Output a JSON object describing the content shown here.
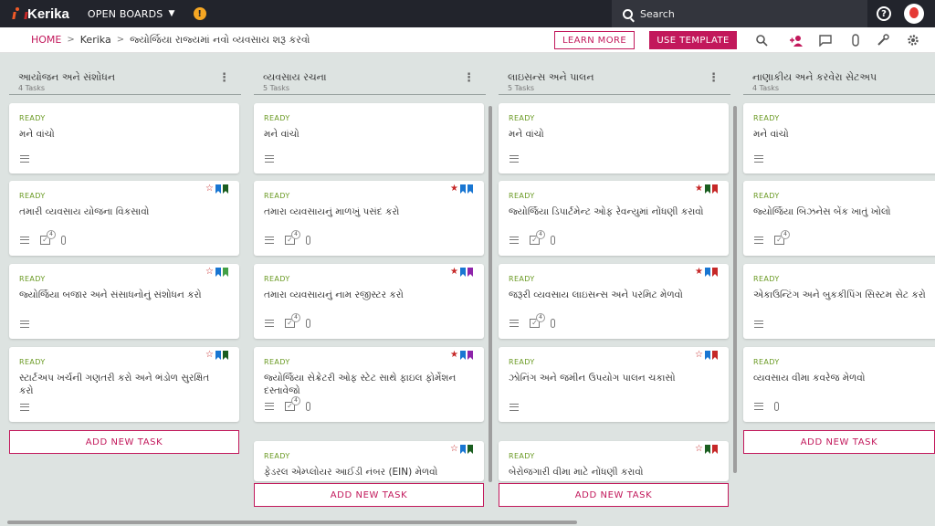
{
  "topbar": {
    "logo": "Kerika",
    "open_boards": "OPEN BOARDS",
    "alert": "!",
    "search_placeholder": "Search",
    "help": "?"
  },
  "breadcrumb": {
    "home": "HOME",
    "org": "Kerika",
    "board": "જ્યોર્જિયા રાજ્યમાં નવો વ્યવસાય શરૂ કરવો"
  },
  "buttons": {
    "learn_more": "LEARN MORE",
    "use_template": "USE TEMPLATE"
  },
  "colors": {
    "accent": "#c2185b",
    "ready": "#6a9a23",
    "topbar": "#22242c",
    "board_bg": "#dde3e1"
  },
  "columns": [
    {
      "title": "આયોજન અને સંશોધન",
      "count": "4 Tasks",
      "add_task": "ADD NEW TASK",
      "cards": [
        {
          "status": "READY",
          "title": "મને વાંચો",
          "star": "",
          "flags": [],
          "checklist": "",
          "attachment": false
        },
        {
          "status": "READY",
          "title": "તમારી વ્યવસાય યોજના વિકસાવો",
          "star": "empty",
          "flags": [
            "#1976d2",
            "#1b5e20"
          ],
          "checklist": "4",
          "attachment": true
        },
        {
          "status": "READY",
          "title": "જ્યોર્જિયા બજાર અને સંસાધનોનું સંશોધન કરો",
          "star": "empty",
          "flags": [
            "#1976d2",
            "#43a047"
          ],
          "checklist": "",
          "attachment": false
        },
        {
          "status": "READY",
          "title": "સ્ટાર્ટઅપ ખર્ચની ગણતરી કરો અને ભંડોળ સુરક્ષિત કરો",
          "star": "empty",
          "flags": [
            "#1976d2",
            "#1b5e20"
          ],
          "checklist": "",
          "attachment": false
        }
      ]
    },
    {
      "title": "વ્યવસાય રચના",
      "count": "5 Tasks",
      "add_task": "ADD NEW TASK",
      "cards": [
        {
          "status": "READY",
          "title": "મને વાંચો",
          "star": "",
          "flags": [],
          "checklist": "",
          "attachment": false
        },
        {
          "status": "READY",
          "title": "તમારા વ્યવસાયનું માળખું પસંદ કરો",
          "star": "filled",
          "flags": [
            "#1976d2",
            "#1976d2"
          ],
          "checklist": "4",
          "attachment": true
        },
        {
          "status": "READY",
          "title": "તમારા વ્યવસાયનું નામ રજીસ્ટર કરો",
          "star": "filled",
          "flags": [
            "#1976d2",
            "#8e24aa"
          ],
          "checklist": "4",
          "attachment": true
        },
        {
          "status": "READY",
          "title": "જ્યોર્જિયા સેક્રેટરી ઓફ સ્ટેટ સાથે ફાઇલ ફોર્મેશન દસ્તાવેજો",
          "star": "filled",
          "flags": [
            "#1976d2",
            "#8e24aa"
          ],
          "checklist": "4",
          "attachment": true
        },
        {
          "status": "READY",
          "title": "ફેડરલ એમ્પ્લોયર આઈડી નંબર (EIN) મેળવો",
          "star": "empty",
          "flags": [
            "#1976d2",
            "#1b5e20"
          ],
          "checklist": "",
          "attachment": false
        }
      ]
    },
    {
      "title": "લાઇસન્સ અને પાલન",
      "count": "5 Tasks",
      "add_task": "ADD NEW TASK",
      "cards": [
        {
          "status": "READY",
          "title": "મને વાંચો",
          "star": "",
          "flags": [],
          "checklist": "",
          "attachment": false
        },
        {
          "status": "READY",
          "title": "જ્યોર્જિયા ડિપાર્ટમેન્ટ ઓફ રેવન્યુમાં નોંધણી કરાવો",
          "star": "filled",
          "flags": [
            "#1b5e20",
            "#c62828"
          ],
          "checklist": "4",
          "attachment": true
        },
        {
          "status": "READY",
          "title": "જરૂરી વ્યવસાય લાઇસન્સ અને પરમિટ મેળવો",
          "star": "filled",
          "flags": [
            "#1976d2",
            "#c62828"
          ],
          "checklist": "4",
          "attachment": true
        },
        {
          "status": "READY",
          "title": "ઝોનિંગ અને જમીન ઉપયોગ પાલન ચકાસો",
          "star": "empty",
          "flags": [
            "#1976d2",
            "#c62828"
          ],
          "checklist": "",
          "attachment": false
        },
        {
          "status": "READY",
          "title": "બેરોજગારી વીમા માટે નોંધણી કરાવો",
          "star": "empty",
          "flags": [
            "#1b5e20",
            "#c62828"
          ],
          "checklist": "",
          "attachment": false
        }
      ]
    },
    {
      "title": "નાણાકીય અને કરવેરા સેટઅપ",
      "count": "4 Tasks",
      "add_task": "ADD NEW TASK",
      "cards": [
        {
          "status": "READY",
          "title": "મને વાંચો",
          "star": "",
          "flags": [],
          "checklist": "",
          "attachment": false
        },
        {
          "status": "READY",
          "title": "જ્યોર્જિયા બિઝનેસ બેંક ખાતું ખોલો",
          "star": "",
          "flags": [],
          "checklist": "4",
          "attachment": false
        },
        {
          "status": "READY",
          "title": "એકાઉન્ટિંગ અને બુકકીપિંગ સિસ્ટમ સેટ કરો",
          "star": "",
          "flags": [],
          "checklist": "",
          "attachment": false
        },
        {
          "status": "READY",
          "title": "વ્યવસાય વીમા કવરેજ મેળવો",
          "star": "",
          "flags": [],
          "checklist": "",
          "attachment": true
        }
      ]
    }
  ]
}
